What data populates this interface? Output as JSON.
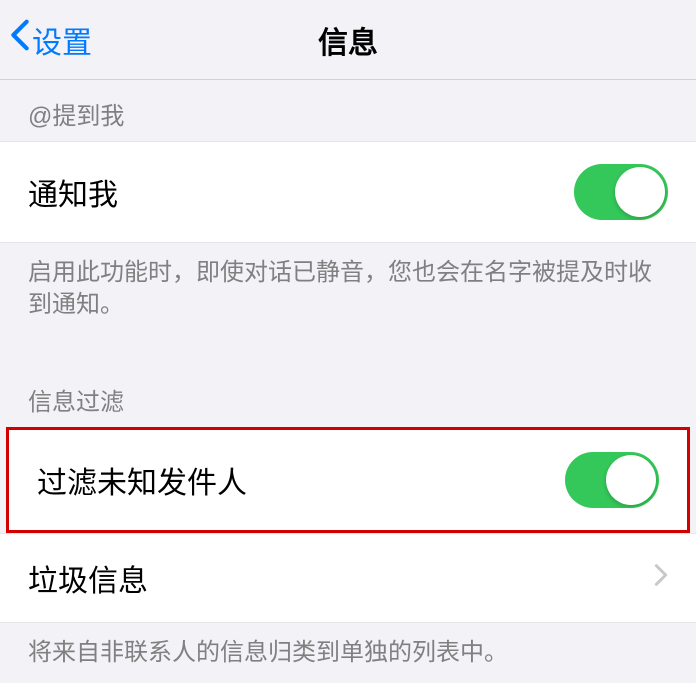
{
  "header": {
    "back_label": "设置",
    "title": "信息"
  },
  "section1": {
    "header": "@提到我",
    "notify_label": "通知我",
    "footer": "启用此功能时，即使对话已静音，您也会在名字被提及时收到通知。"
  },
  "section2": {
    "header": "信息过滤",
    "filter_unknown_label": "过滤未知发件人",
    "junk_label": "垃圾信息",
    "footer": "将来自非联系人的信息归类到单独的列表中。"
  },
  "toggles": {
    "notify_on": true,
    "filter_on": true
  }
}
